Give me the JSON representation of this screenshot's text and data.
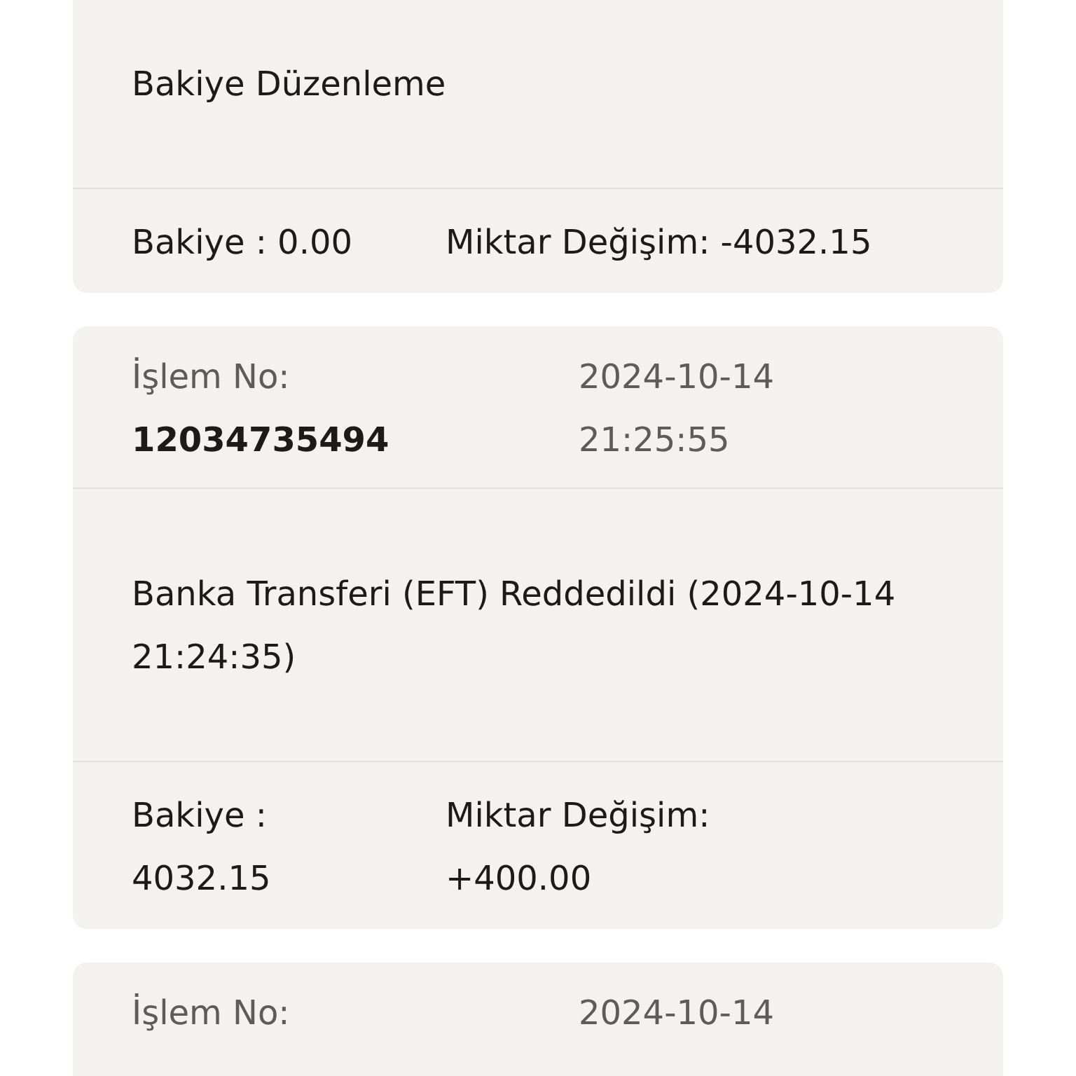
{
  "transactions": [
    {
      "description": "Bakiye Düzenleme",
      "balance": "Bakiye : 0.00",
      "change": "Miktar Değişim: -4032.15"
    },
    {
      "id_label": "İşlem No:",
      "id": "12034735494",
      "date": "2024-10-14",
      "time": "21:25:55",
      "description": "Banka Transferi (EFT) Reddedildi (2024-10-14 21:24:35)",
      "balance": "Bakiye :\n4032.15",
      "change": "Miktar Değişim:\n+400.00"
    },
    {
      "id_label": "İşlem No:",
      "date": "2024-10-14"
    }
  ]
}
